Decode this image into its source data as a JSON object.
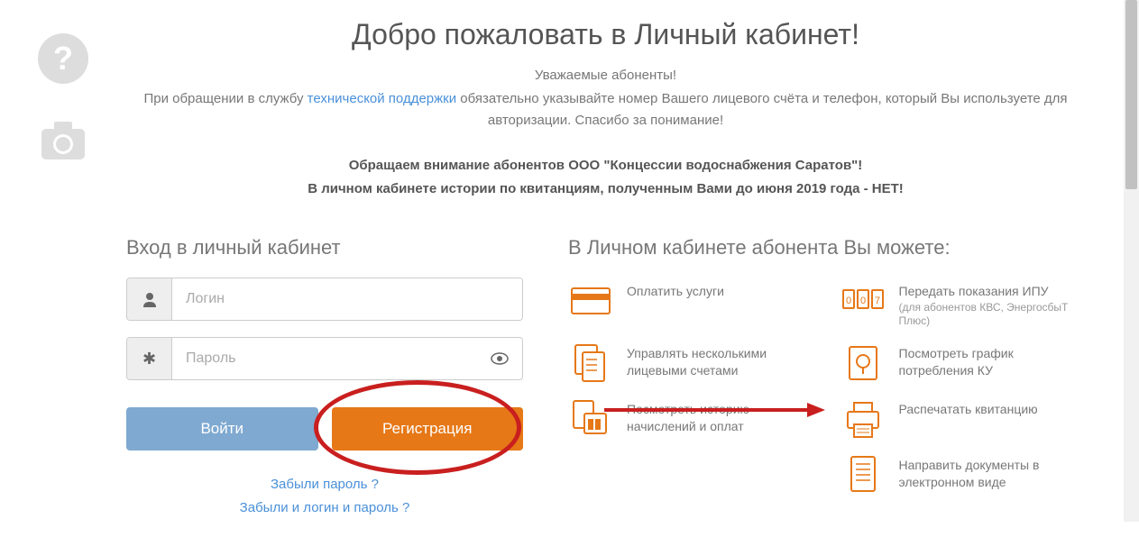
{
  "header": {
    "title": "Добро пожаловать в Личный кабинет!",
    "greeting": "Уважаемые абоненты!",
    "notice_before": "При обращении в службу ",
    "notice_link": "технической поддержки",
    "notice_after": " обязательно указывайте номер Вашего лицевого счёта и телефон, который Вы используете для авторизации. Спасибо за понимание!",
    "warning_line1": "Обращаем внимание абонентов ООО \"Концессии водоснабжения Саратов\"!",
    "warning_line2": "В личном кабинете истории по квитанциям, полученным Вами до июня 2019 года - НЕТ!"
  },
  "login": {
    "heading": "Вход в личный кабинет",
    "login_placeholder": "Логин",
    "password_placeholder": "Пароль",
    "login_button": "Войти",
    "register_button": "Регистрация",
    "forgot_password": "Забыли пароль ?",
    "forgot_login_password": "Забыли и логин и пароль ?"
  },
  "features": {
    "heading": "В Личном кабинете абонента Вы можете:",
    "items": [
      {
        "label": "Оплатить услуги"
      },
      {
        "label": "Передать показания ИПУ",
        "sublabel": "(для абонентов КВС, ЭнергосбыТ Плюс)"
      },
      {
        "label": "Управлять несколькими лицевыми счетами"
      },
      {
        "label": "Посмотреть график потребления КУ"
      },
      {
        "label": "Посмотреть историю начислений и оплат"
      },
      {
        "label": "Распечатать квитанцию"
      },
      {
        "label": ""
      },
      {
        "label": "Направить документы в электронном виде"
      }
    ]
  }
}
